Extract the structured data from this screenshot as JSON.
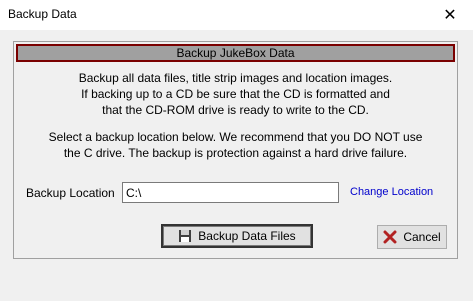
{
  "window": {
    "title": "Backup Data",
    "close_glyph": "✕"
  },
  "panel": {
    "header": "Backup JukeBox Data",
    "para1": [
      "Backup all data files, title strip images and location images.",
      "If backing up to a CD be sure that the CD is formatted and",
      "that the CD-ROM drive is ready to write to the CD."
    ],
    "para2": [
      "Select a backup location below. We recommend that you DO NOT use",
      "the C drive.  The backup is protection against a hard drive failure."
    ]
  },
  "location": {
    "label": "Backup Location",
    "value": "C:\\",
    "change_link": "Change Location"
  },
  "buttons": {
    "backup": {
      "label": "Backup Data Files",
      "icon": "floppy-disk-icon"
    },
    "cancel": {
      "label": "Cancel",
      "icon": "red-x-icon"
    }
  },
  "colors": {
    "header_border": "#7a0000",
    "link": "#0000cc",
    "cancel_x": "#b22222"
  }
}
